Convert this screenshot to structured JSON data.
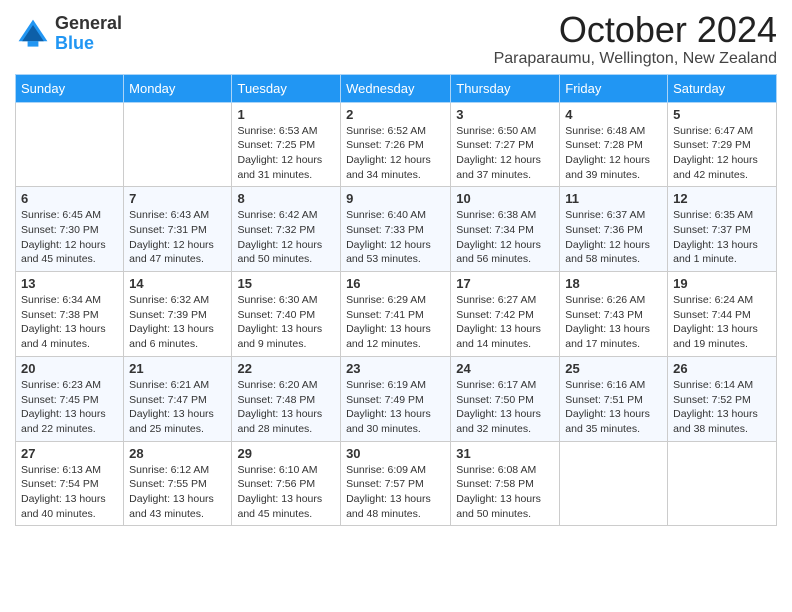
{
  "logo": {
    "general": "General",
    "blue": "Blue"
  },
  "header": {
    "title": "October 2024",
    "subtitle": "Paraparaumu, Wellington, New Zealand"
  },
  "days_of_week": [
    "Sunday",
    "Monday",
    "Tuesday",
    "Wednesday",
    "Thursday",
    "Friday",
    "Saturday"
  ],
  "weeks": [
    [
      {
        "day": "",
        "info": ""
      },
      {
        "day": "",
        "info": ""
      },
      {
        "day": "1",
        "info": "Sunrise: 6:53 AM\nSunset: 7:25 PM\nDaylight: 12 hours and 31 minutes."
      },
      {
        "day": "2",
        "info": "Sunrise: 6:52 AM\nSunset: 7:26 PM\nDaylight: 12 hours and 34 minutes."
      },
      {
        "day": "3",
        "info": "Sunrise: 6:50 AM\nSunset: 7:27 PM\nDaylight: 12 hours and 37 minutes."
      },
      {
        "day": "4",
        "info": "Sunrise: 6:48 AM\nSunset: 7:28 PM\nDaylight: 12 hours and 39 minutes."
      },
      {
        "day": "5",
        "info": "Sunrise: 6:47 AM\nSunset: 7:29 PM\nDaylight: 12 hours and 42 minutes."
      }
    ],
    [
      {
        "day": "6",
        "info": "Sunrise: 6:45 AM\nSunset: 7:30 PM\nDaylight: 12 hours and 45 minutes."
      },
      {
        "day": "7",
        "info": "Sunrise: 6:43 AM\nSunset: 7:31 PM\nDaylight: 12 hours and 47 minutes."
      },
      {
        "day": "8",
        "info": "Sunrise: 6:42 AM\nSunset: 7:32 PM\nDaylight: 12 hours and 50 minutes."
      },
      {
        "day": "9",
        "info": "Sunrise: 6:40 AM\nSunset: 7:33 PM\nDaylight: 12 hours and 53 minutes."
      },
      {
        "day": "10",
        "info": "Sunrise: 6:38 AM\nSunset: 7:34 PM\nDaylight: 12 hours and 56 minutes."
      },
      {
        "day": "11",
        "info": "Sunrise: 6:37 AM\nSunset: 7:36 PM\nDaylight: 12 hours and 58 minutes."
      },
      {
        "day": "12",
        "info": "Sunrise: 6:35 AM\nSunset: 7:37 PM\nDaylight: 13 hours and 1 minute."
      }
    ],
    [
      {
        "day": "13",
        "info": "Sunrise: 6:34 AM\nSunset: 7:38 PM\nDaylight: 13 hours and 4 minutes."
      },
      {
        "day": "14",
        "info": "Sunrise: 6:32 AM\nSunset: 7:39 PM\nDaylight: 13 hours and 6 minutes."
      },
      {
        "day": "15",
        "info": "Sunrise: 6:30 AM\nSunset: 7:40 PM\nDaylight: 13 hours and 9 minutes."
      },
      {
        "day": "16",
        "info": "Sunrise: 6:29 AM\nSunset: 7:41 PM\nDaylight: 13 hours and 12 minutes."
      },
      {
        "day": "17",
        "info": "Sunrise: 6:27 AM\nSunset: 7:42 PM\nDaylight: 13 hours and 14 minutes."
      },
      {
        "day": "18",
        "info": "Sunrise: 6:26 AM\nSunset: 7:43 PM\nDaylight: 13 hours and 17 minutes."
      },
      {
        "day": "19",
        "info": "Sunrise: 6:24 AM\nSunset: 7:44 PM\nDaylight: 13 hours and 19 minutes."
      }
    ],
    [
      {
        "day": "20",
        "info": "Sunrise: 6:23 AM\nSunset: 7:45 PM\nDaylight: 13 hours and 22 minutes."
      },
      {
        "day": "21",
        "info": "Sunrise: 6:21 AM\nSunset: 7:47 PM\nDaylight: 13 hours and 25 minutes."
      },
      {
        "day": "22",
        "info": "Sunrise: 6:20 AM\nSunset: 7:48 PM\nDaylight: 13 hours and 28 minutes."
      },
      {
        "day": "23",
        "info": "Sunrise: 6:19 AM\nSunset: 7:49 PM\nDaylight: 13 hours and 30 minutes."
      },
      {
        "day": "24",
        "info": "Sunrise: 6:17 AM\nSunset: 7:50 PM\nDaylight: 13 hours and 32 minutes."
      },
      {
        "day": "25",
        "info": "Sunrise: 6:16 AM\nSunset: 7:51 PM\nDaylight: 13 hours and 35 minutes."
      },
      {
        "day": "26",
        "info": "Sunrise: 6:14 AM\nSunset: 7:52 PM\nDaylight: 13 hours and 38 minutes."
      }
    ],
    [
      {
        "day": "27",
        "info": "Sunrise: 6:13 AM\nSunset: 7:54 PM\nDaylight: 13 hours and 40 minutes."
      },
      {
        "day": "28",
        "info": "Sunrise: 6:12 AM\nSunset: 7:55 PM\nDaylight: 13 hours and 43 minutes."
      },
      {
        "day": "29",
        "info": "Sunrise: 6:10 AM\nSunset: 7:56 PM\nDaylight: 13 hours and 45 minutes."
      },
      {
        "day": "30",
        "info": "Sunrise: 6:09 AM\nSunset: 7:57 PM\nDaylight: 13 hours and 48 minutes."
      },
      {
        "day": "31",
        "info": "Sunrise: 6:08 AM\nSunset: 7:58 PM\nDaylight: 13 hours and 50 minutes."
      },
      {
        "day": "",
        "info": ""
      },
      {
        "day": "",
        "info": ""
      }
    ]
  ]
}
